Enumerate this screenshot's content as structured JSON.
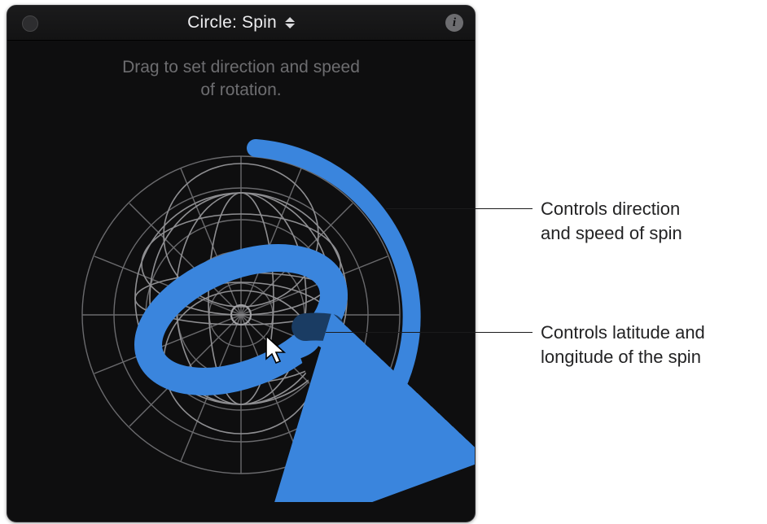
{
  "titlebar": {
    "title": "Circle: Spin"
  },
  "hint": {
    "line1": "Drag to set direction and speed",
    "line2": "of rotation."
  },
  "callouts": {
    "speed": {
      "line1": "Controls direction",
      "line2": "and speed of spin"
    },
    "orbit": {
      "line1": "Controls latitude and",
      "line2": "longitude of the spin"
    }
  },
  "colors": {
    "accent": "#3a85dd",
    "panel_bg": "#0e0e0f",
    "grid": "#6a6a6d",
    "sphere": "#8f8f92",
    "text_muted": "#6d6d70"
  },
  "icons": {
    "window_dot": "window-dot-icon",
    "popup_disclosure": "popup-disclosure-icon",
    "info": "info-button",
    "grid_disc": "grid-disc-icon",
    "wire_sphere": "wire-sphere-icon",
    "orbit_ring": "orbit-ring-control-icon",
    "speed_arc": "speed-arc-control-icon",
    "center_pivot": "center-pivot-icon",
    "cursor": "cursor-icon"
  }
}
